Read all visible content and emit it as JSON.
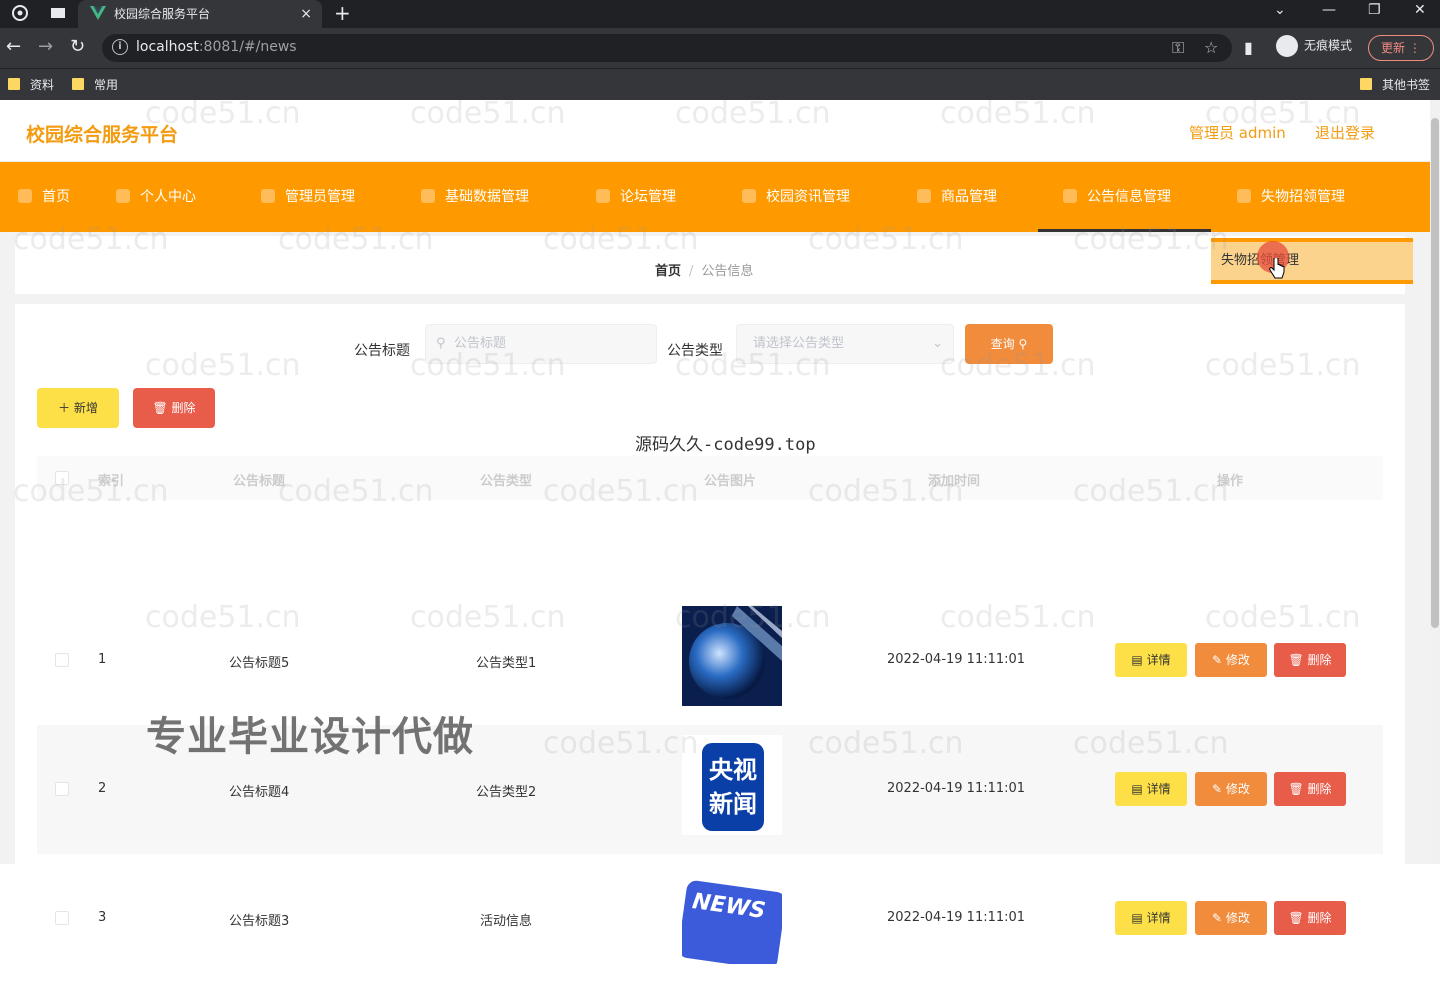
{
  "browser": {
    "tab_title": "校园综合服务平台",
    "tab_close": "×",
    "new_tab": "+",
    "url_host": "localhost",
    "url_rest": ":8081/#/news",
    "incognito_label": "无痕模式",
    "update_label": "更新",
    "bookmarks": [
      "资料",
      "常用"
    ],
    "other_bookmarks": "其他书签"
  },
  "header": {
    "brand": "校园综合服务平台",
    "user_label": "管理员 admin",
    "logout_label": "退出登录"
  },
  "menu": [
    "首页",
    "个人中心",
    "管理员管理",
    "基础数据管理",
    "论坛管理",
    "校园资讯管理",
    "商品管理",
    "公告信息管理",
    "失物招领管理"
  ],
  "dropdown": {
    "item": "失物招领管理"
  },
  "breadcrumb": {
    "home": "首页",
    "separator": "/",
    "current": "公告信息"
  },
  "search": {
    "title_label": "公告标题",
    "title_placeholder": "公告标题",
    "type_label": "公告类型",
    "type_placeholder": "请选择公告类型",
    "query_button": "查询"
  },
  "toolbar": {
    "add_button": "新增",
    "delete_button": "删除"
  },
  "center_watermark": "源码久久-code99.top",
  "table": {
    "columns": [
      "索引",
      "公告标题",
      "公告类型",
      "公告图片",
      "添加时间",
      "操作"
    ],
    "rows": [
      {
        "index": "1",
        "title": "公告标题5",
        "type": "公告类型1",
        "image": "globe-news",
        "time": "2022-04-19 11:11:01"
      },
      {
        "index": "2",
        "title": "公告标题4",
        "type": "公告类型2",
        "image": "cctv-news",
        "time": "2022-04-19 11:11:01",
        "image_text": [
          "央视",
          "新闻"
        ]
      },
      {
        "index": "3",
        "title": "公告标题3",
        "type": "活动信息",
        "image": "news-key",
        "time": "2022-04-19 11:11:01",
        "image_text": [
          "NEWS"
        ]
      }
    ],
    "actions": {
      "detail": "详情",
      "edit": "修改",
      "remove": "删除"
    }
  },
  "watermark_text": "code51.cn",
  "overlay_ad": "专业毕业设计代做",
  "colors": {
    "brand": "#f39c12",
    "menu_bg": "#ff9900",
    "detail_btn": "#fde047",
    "edit_btn": "#f08c3c",
    "delete_btn": "#e85c4a"
  }
}
